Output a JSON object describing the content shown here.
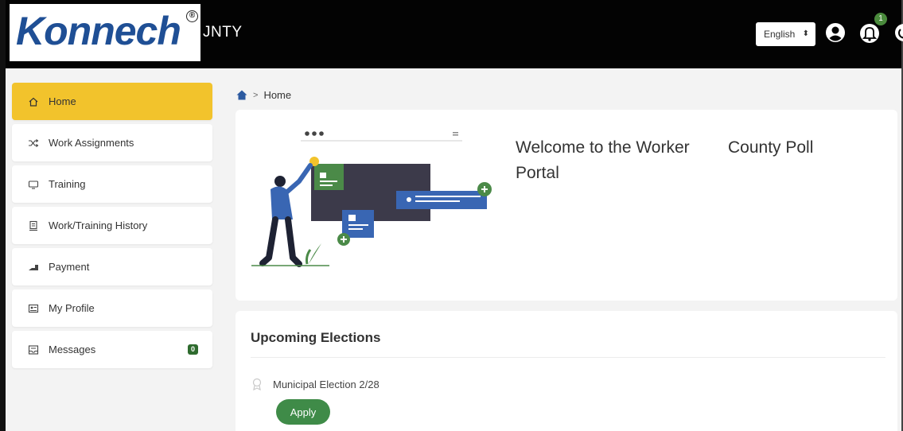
{
  "header": {
    "logo_text": "Konnech",
    "logo_registered": "®",
    "county_suffix": "JNTY",
    "language": "English",
    "language_caret": "⬍",
    "notification_count": "1"
  },
  "breadcrumb": {
    "separator": ">",
    "current": "Home"
  },
  "sidebar": {
    "items": [
      {
        "label": "Home",
        "icon": "home-icon",
        "active": true
      },
      {
        "label": "Work Assignments",
        "icon": "shuffle-icon",
        "active": false
      },
      {
        "label": "Training",
        "icon": "monitor-icon",
        "active": false
      },
      {
        "label": "Work/Training History",
        "icon": "history-icon",
        "active": false
      },
      {
        "label": "Payment",
        "icon": "payment-icon",
        "active": false
      },
      {
        "label": "My Profile",
        "icon": "profile-card-icon",
        "active": false
      },
      {
        "label": "Messages",
        "icon": "messages-icon",
        "active": false,
        "badge": "0"
      }
    ]
  },
  "welcome": {
    "title": "Welcome to the Worker Portal",
    "org": "County Poll"
  },
  "elections": {
    "title": "Upcoming Elections",
    "items": [
      {
        "name": "Municipal Election 2/28",
        "action_label": "Apply"
      }
    ]
  },
  "colors": {
    "header_bg": "#030303",
    "logo_blue": "#1f4f95",
    "active_item": "#f2c32c",
    "accent_green": "#3f8b48",
    "illustration_blue": "#3966b3",
    "illustration_dark": "#3c3a4a"
  }
}
